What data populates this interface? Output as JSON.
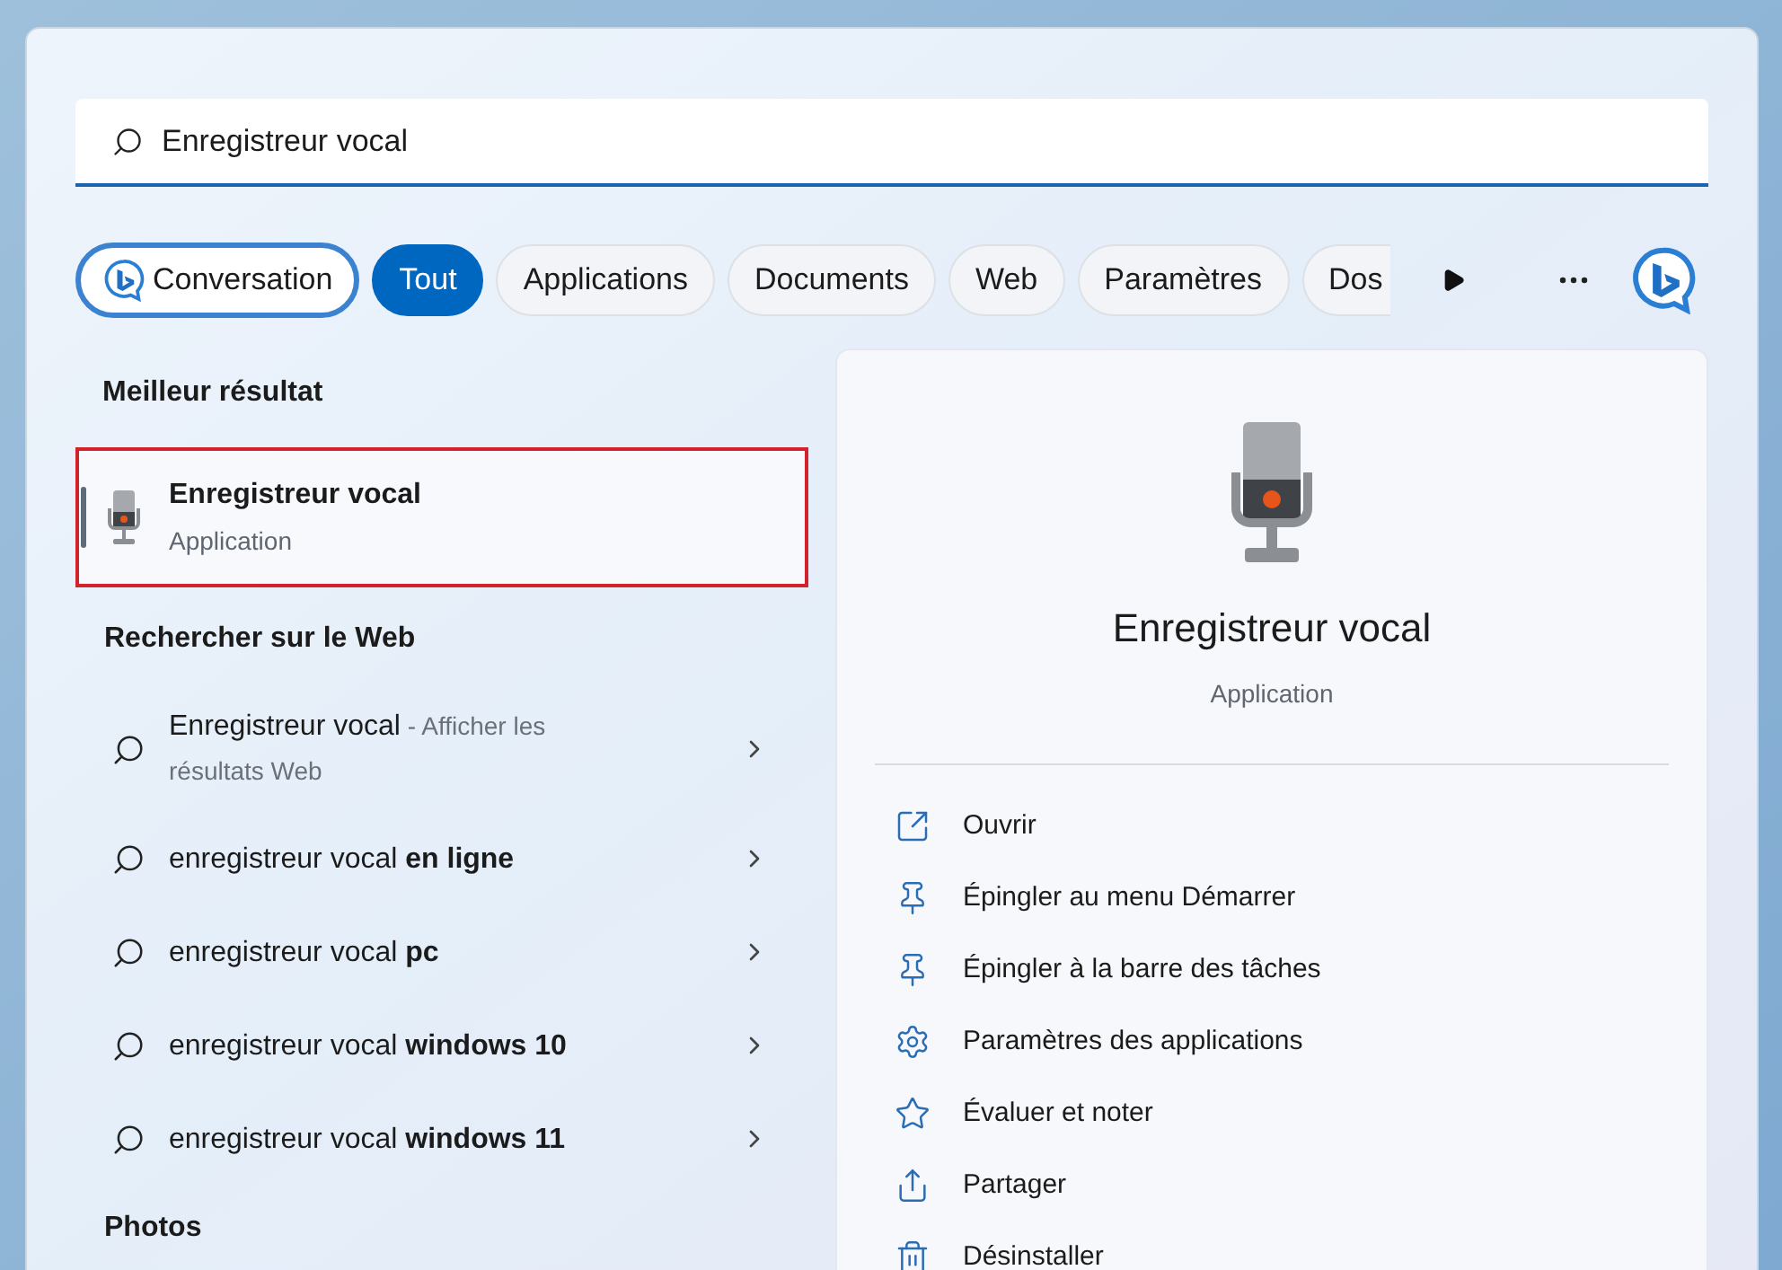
{
  "search": {
    "value": "Enregistreur vocal"
  },
  "filters": [
    {
      "kind": "bing",
      "label": "Conversation",
      "selected": false
    },
    {
      "kind": "chip",
      "label": "Tout",
      "selected": true
    },
    {
      "kind": "chip",
      "label": "Applications",
      "selected": false
    },
    {
      "kind": "chip",
      "label": "Documents",
      "selected": false
    },
    {
      "kind": "chip",
      "label": "Web",
      "selected": false
    },
    {
      "kind": "chip",
      "label": "Paramètres",
      "selected": false
    },
    {
      "kind": "chip",
      "label": "Dos",
      "selected": false
    }
  ],
  "best_match": {
    "heading": "Meilleur résultat",
    "title": "Enregistreur vocal",
    "subtitle": "Application",
    "selected": true,
    "annotated": true
  },
  "web": {
    "heading": "Rechercher sur le Web",
    "results": [
      {
        "text": "Enregistreur vocal",
        "note": " - Afficher les résultats Web"
      },
      {
        "text": "enregistreur vocal **en ligne**"
      },
      {
        "text": "enregistreur vocal **pc**"
      },
      {
        "text": "enregistreur vocal **windows 10**"
      },
      {
        "text": "enregistreur vocal **windows 11**"
      }
    ]
  },
  "photos": {
    "heading": "Photos"
  },
  "detail": {
    "title": "Enregistreur vocal",
    "subtitle": "Application",
    "actions": [
      {
        "kind": "open",
        "label": "Ouvrir"
      },
      {
        "kind": "pin",
        "label": "Épingler au menu Démarrer"
      },
      {
        "kind": "pin",
        "label": "Épingler à la barre des tâches"
      },
      {
        "kind": "settings",
        "label": "Paramètres des applications"
      },
      {
        "kind": "rate",
        "label": "Évaluer et noter"
      },
      {
        "kind": "share",
        "label": "Partager"
      },
      {
        "kind": "uninstall",
        "label": "Désinstaller"
      }
    ]
  }
}
